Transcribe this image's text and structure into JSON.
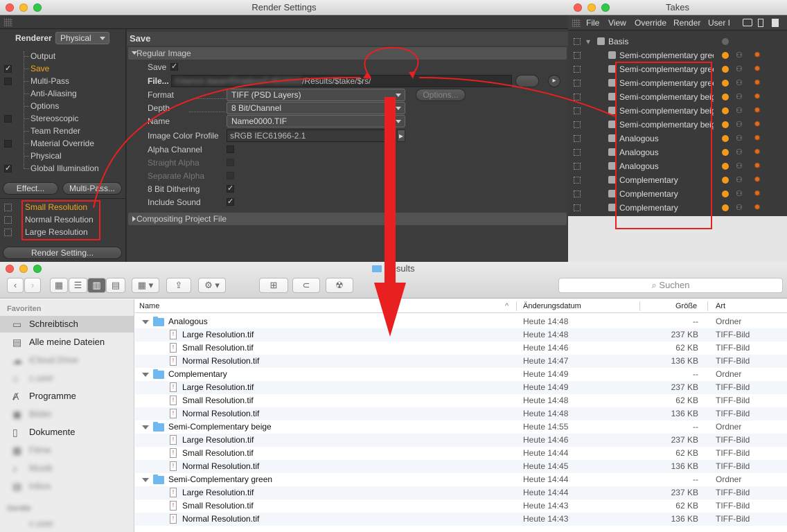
{
  "render_settings": {
    "window_title": "Render Settings",
    "renderer_label": "Renderer",
    "renderer_value": "Physical",
    "tree": [
      {
        "label": "Output",
        "checkbox": false,
        "checked": false,
        "active": false
      },
      {
        "label": "Save",
        "checkbox": true,
        "checked": true,
        "active": true
      },
      {
        "label": "Multi-Pass",
        "checkbox": true,
        "checked": false,
        "active": false
      },
      {
        "label": "Anti-Aliasing",
        "checkbox": false,
        "checked": false,
        "active": false
      },
      {
        "label": "Options",
        "checkbox": false,
        "checked": false,
        "active": false
      },
      {
        "label": "Stereoscopic",
        "checkbox": true,
        "checked": false,
        "active": false
      },
      {
        "label": "Team Render",
        "checkbox": false,
        "checked": false,
        "active": false
      },
      {
        "label": "Material Override",
        "checkbox": true,
        "checked": false,
        "active": false
      },
      {
        "label": "Physical",
        "checkbox": false,
        "checked": false,
        "active": false
      },
      {
        "label": "Global Illumination",
        "checkbox": true,
        "checked": true,
        "active": false
      }
    ],
    "effect_button": "Effect...",
    "multipass_button": "Multi-Pass...",
    "presets": [
      "Small Resolution",
      "Normal Resolution",
      "Large Resolution"
    ],
    "render_setting_button": "Render Setting...",
    "section_title": "Save",
    "regular_image_label": "Regular Image",
    "save_label": "Save",
    "save_checked": true,
    "file_label": "File...",
    "file_path_blurred": "/Users/c.bauer/Dropbox/C4D/2015",
    "file_path_visible": "/Results/$take/$rs/",
    "format_label": "Format",
    "format_value": "TIFF (PSD Layers)",
    "options_button": "Options...",
    "depth_label": "Depth",
    "depth_value": "8 Bit/Channel",
    "name_label": "Name",
    "name_value": "Name0000.TIF",
    "profile_label": "Image Color Profile",
    "profile_value": "sRGB IEC61966-2.1",
    "alpha_label": "Alpha Channel",
    "straight_alpha_label": "Straight Alpha",
    "separate_alpha_label": "Separate Alpha",
    "dithering_label": "8 Bit Dithering",
    "sound_label": "Include Sound",
    "compositing_label": "Compositing Project File"
  },
  "takes": {
    "window_title": "Takes",
    "menu": [
      "File",
      "View",
      "Override",
      "Render",
      "User I"
    ],
    "root": "Basis",
    "items": [
      "Semi-complementary green",
      "Semi-complementary green",
      "Semi-complementary green",
      "Semi-complementary beige",
      "Semi-complementary beige",
      "Semi-complementary beige",
      "Analogous",
      "Analogous",
      "Analogous",
      "Complementary",
      "Complementary",
      "Complementary"
    ]
  },
  "finder": {
    "window_title": "Results",
    "search_placeholder": "Suchen",
    "sidebar_header": "Favoriten",
    "sidebar_items": [
      {
        "label": "Schreibtisch",
        "icon": "desktop-icon",
        "blurred": false
      },
      {
        "label": "Alle meine Dateien",
        "icon": "all-files-icon",
        "blurred": false
      },
      {
        "label": "iCloud Drive",
        "icon": "cloud-icon",
        "blurred": true
      },
      {
        "label": "c.user",
        "icon": "home-icon",
        "blurred": true
      },
      {
        "label": "Programme",
        "icon": "apps-icon",
        "blurred": false
      },
      {
        "label": "Bilder",
        "icon": "pictures-icon",
        "blurred": true
      },
      {
        "label": "Dokumente",
        "icon": "documents-icon",
        "blurred": false
      },
      {
        "label": "Filme",
        "icon": "movies-icon",
        "blurred": true
      },
      {
        "label": "Musik",
        "icon": "music-icon",
        "blurred": true
      },
      {
        "label": "Inbox",
        "icon": "inbox-icon",
        "blurred": true
      }
    ],
    "sidebar_header2": "Geräte",
    "columns": {
      "name": "Name",
      "date": "Änderungsdatum",
      "size": "Größe",
      "kind": "Art"
    },
    "rows": [
      {
        "type": "folder",
        "name": "Analogous",
        "date": "Heute 14:48",
        "size": "--",
        "kind": "Ordner"
      },
      {
        "type": "file",
        "name": "Large Resolution.tif",
        "date": "Heute 14:48",
        "size": "237 KB",
        "kind": "TIFF-Bild"
      },
      {
        "type": "file",
        "name": "Small Resolution.tif",
        "date": "Heute 14:46",
        "size": "62 KB",
        "kind": "TIFF-Bild"
      },
      {
        "type": "file",
        "name": "Normal Resolution.tif",
        "date": "Heute 14:47",
        "size": "136 KB",
        "kind": "TIFF-Bild"
      },
      {
        "type": "folder",
        "name": "Complementary",
        "date": "Heute 14:49",
        "size": "--",
        "kind": "Ordner"
      },
      {
        "type": "file",
        "name": "Large Resolution.tif",
        "date": "Heute 14:49",
        "size": "237 KB",
        "kind": "TIFF-Bild"
      },
      {
        "type": "file",
        "name": "Small Resolution.tif",
        "date": "Heute 14:48",
        "size": "62 KB",
        "kind": "TIFF-Bild"
      },
      {
        "type": "file",
        "name": "Normal Resolution.tif",
        "date": "Heute 14:48",
        "size": "136 KB",
        "kind": "TIFF-Bild"
      },
      {
        "type": "folder",
        "name": "Semi-Complementary beige",
        "date": "Heute 14:55",
        "size": "--",
        "kind": "Ordner"
      },
      {
        "type": "file",
        "name": "Large Resolution.tif",
        "date": "Heute 14:46",
        "size": "237 KB",
        "kind": "TIFF-Bild"
      },
      {
        "type": "file",
        "name": "Small Resolution.tif",
        "date": "Heute 14:44",
        "size": "62 KB",
        "kind": "TIFF-Bild"
      },
      {
        "type": "file",
        "name": "Normal Resolution.tif",
        "date": "Heute 14:45",
        "size": "136 KB",
        "kind": "TIFF-Bild"
      },
      {
        "type": "folder",
        "name": "Semi-Complementary green",
        "date": "Heute 14:44",
        "size": "--",
        "kind": "Ordner"
      },
      {
        "type": "file",
        "name": "Large Resolution.tif",
        "date": "Heute 14:44",
        "size": "237 KB",
        "kind": "TIFF-Bild"
      },
      {
        "type": "file",
        "name": "Small Resolution.tif",
        "date": "Heute 14:43",
        "size": "62 KB",
        "kind": "TIFF-Bild"
      },
      {
        "type": "file",
        "name": "Normal Resolution.tif",
        "date": "Heute 14:43",
        "size": "136 KB",
        "kind": "TIFF-Bild"
      }
    ]
  },
  "colors": {
    "annotation": "#e82020",
    "active_item": "#f5a623",
    "folder": "#6fb9f0"
  }
}
